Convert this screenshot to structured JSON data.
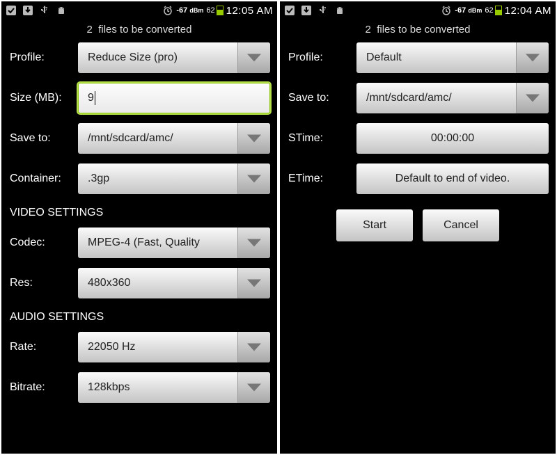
{
  "left": {
    "status": {
      "signal": "-67",
      "signal_unit": "dBm",
      "battery": "62",
      "time": "12:05 AM"
    },
    "subhead_count": "2",
    "subhead_text": "files to be converted",
    "labels": {
      "profile": "Profile:",
      "size": "Size (MB):",
      "save": "Save to:",
      "container": "Container:",
      "video_section": "VIDEO SETTINGS",
      "codec": "Codec:",
      "res": "Res:",
      "audio_section": "AUDIO SETTINGS",
      "rate": "Rate:",
      "bitrate": "Bitrate:"
    },
    "values": {
      "profile": "Reduce Size (pro)",
      "size": "9",
      "save": "/mnt/sdcard/amc/",
      "container": ".3gp",
      "codec": "MPEG-4 (Fast, Quality",
      "res": "480x360",
      "rate": "22050 Hz",
      "bitrate": "128kbps"
    }
  },
  "right": {
    "status": {
      "signal": "-67",
      "signal_unit": "dBm",
      "battery": "62",
      "time": "12:04 AM"
    },
    "subhead_count": "2",
    "subhead_text": "files to be converted",
    "labels": {
      "profile": "Profile:",
      "save": "Save to:",
      "stime": "STime:",
      "etime": "ETime:"
    },
    "values": {
      "profile": "Default",
      "save": "/mnt/sdcard/amc/",
      "stime": "00:00:00",
      "etime": "Default to end of video."
    },
    "buttons": {
      "start": "Start",
      "cancel": "Cancel"
    }
  }
}
